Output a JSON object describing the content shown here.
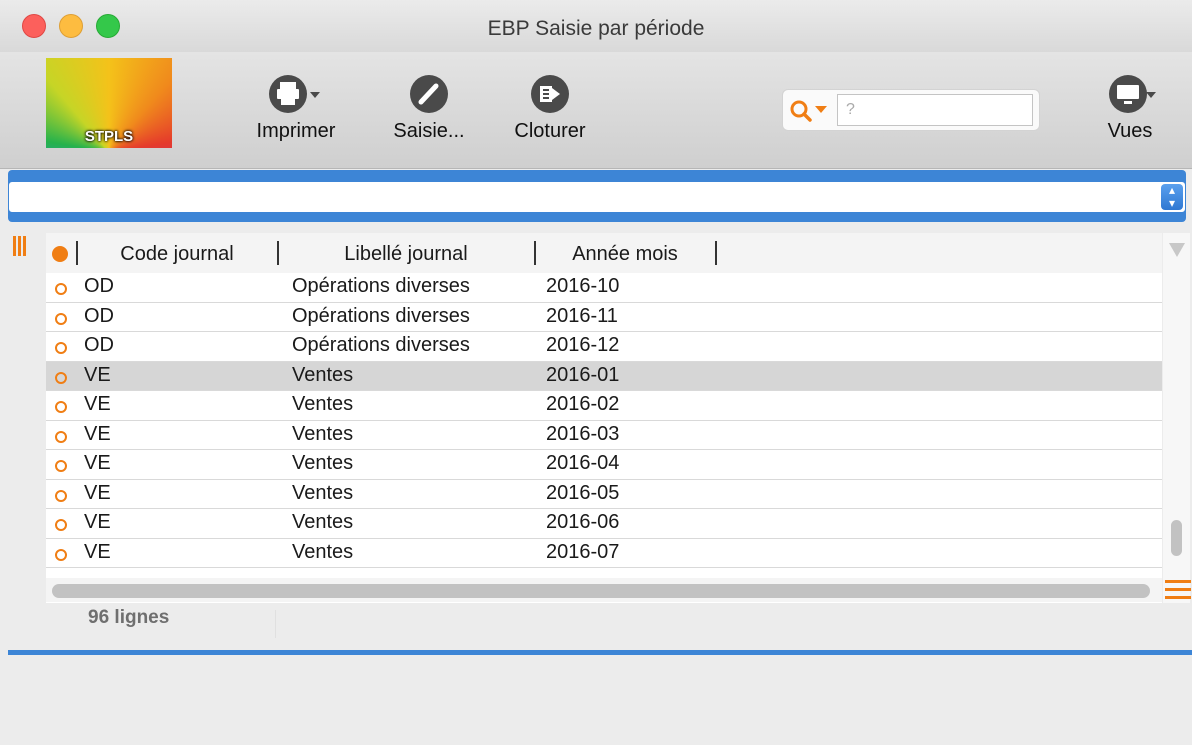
{
  "window": {
    "title": "EBP Saisie par période"
  },
  "toolbar": {
    "logo_text": "STPLS",
    "print_label": "Imprimer",
    "edit_label": "Saisie...",
    "close_label": "Cloturer",
    "views_label": "Vues",
    "search_placeholder": "?",
    "icons": [
      "printer-icon",
      "pencil-icon",
      "exit-icon",
      "search-icon",
      "monitor-icon"
    ]
  },
  "selector": {
    "value": ""
  },
  "table": {
    "columns": [
      "Code journal",
      "Libellé journal",
      "Année mois"
    ],
    "rows": [
      {
        "code": "OD",
        "libelle": "Opérations diverses",
        "annee_mois": "2016-10"
      },
      {
        "code": "OD",
        "libelle": "Opérations diverses",
        "annee_mois": "2016-11"
      },
      {
        "code": "OD",
        "libelle": "Opérations diverses",
        "annee_mois": "2016-12"
      },
      {
        "code": "VE",
        "libelle": "Ventes",
        "annee_mois": "2016-01"
      },
      {
        "code": "VE",
        "libelle": "Ventes",
        "annee_mois": "2016-02"
      },
      {
        "code": "VE",
        "libelle": "Ventes",
        "annee_mois": "2016-03"
      },
      {
        "code": "VE",
        "libelle": "Ventes",
        "annee_mois": "2016-04"
      },
      {
        "code": "VE",
        "libelle": "Ventes",
        "annee_mois": "2016-05"
      },
      {
        "code": "VE",
        "libelle": "Ventes",
        "annee_mois": "2016-06"
      },
      {
        "code": "VE",
        "libelle": "Ventes",
        "annee_mois": "2016-07"
      }
    ],
    "selected_row": 3
  },
  "footer": {
    "count": "96 lignes"
  },
  "colors": {
    "accent": "#3d85d6",
    "orange": "#f07e14"
  }
}
